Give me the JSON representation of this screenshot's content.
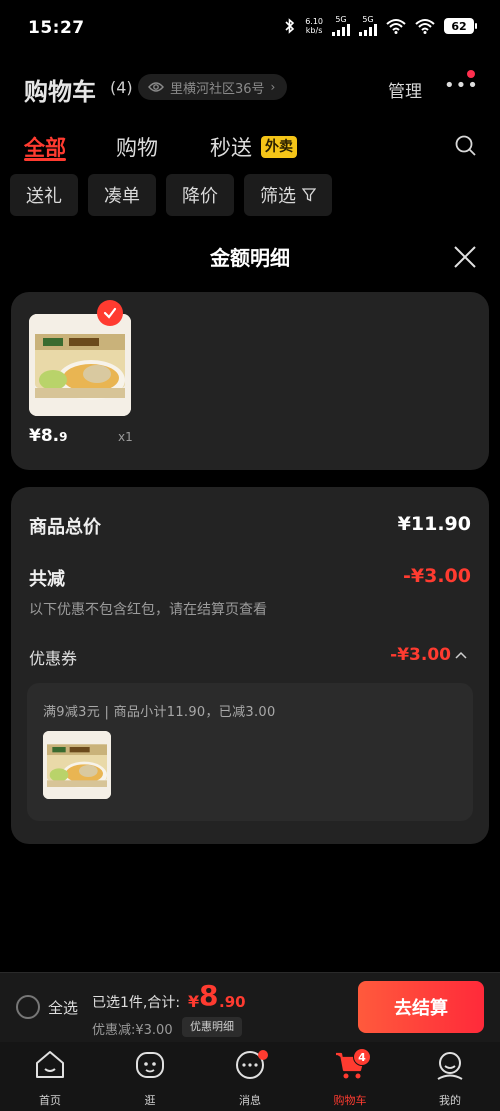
{
  "status_bar": {
    "time": "15:27",
    "speed_value": "6.10",
    "speed_unit": "kb/s",
    "net1": "5G",
    "net2": "5G",
    "battery": "62"
  },
  "header": {
    "title": "购物车",
    "count": "(4)",
    "address": "里横河社区36号",
    "manage": "管理"
  },
  "tabs": {
    "items": [
      "全部",
      "购物",
      "秒送"
    ],
    "badge": "外卖",
    "active": "全部"
  },
  "filters": [
    "送礼",
    "凑单",
    "降价",
    "筛选"
  ],
  "sheet": {
    "title": "金额明细"
  },
  "item": {
    "price_symbol": "¥",
    "price_int": "8.",
    "price_dec": "9",
    "quantity": "x1"
  },
  "summary": {
    "total_label": "商品总价",
    "total_value": "¥11.90",
    "reduction_label": "共减",
    "reduction_value": "-¥3.00",
    "note": "以下优惠不包含红包，请在结算页查看",
    "coupon_label": "优惠券",
    "coupon_value": "-¥3.00",
    "coupon_desc": "满9减3元 | 商品小计11.90，已减3.00"
  },
  "bottom_bar": {
    "select_all": "全选",
    "selected_text": "已选1件,合计:",
    "total_symbol": "¥",
    "total_int": "8",
    "total_dec": ".90",
    "discount_text": "优惠减:¥3.00",
    "detail_chip": "优惠明细",
    "checkout": "去结算"
  },
  "tabbar": {
    "items": [
      "首页",
      "逛",
      "消息",
      "购物车",
      "我的"
    ],
    "cart_badge": "4",
    "active": "购物车"
  },
  "colors": {
    "accent": "#ff3b30",
    "badge_yellow": "#f5c518",
    "card_bg": "#232323"
  }
}
